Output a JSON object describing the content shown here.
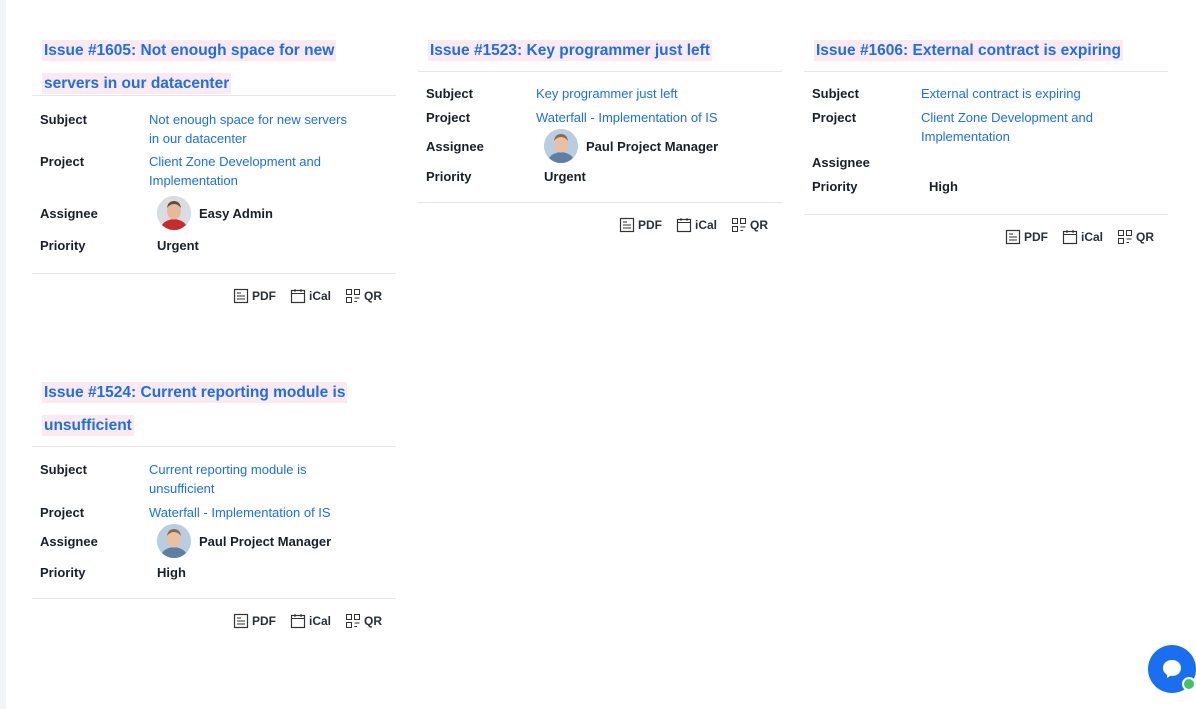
{
  "labels": {
    "subject": "Subject",
    "project": "Project",
    "assignee": "Assignee",
    "priority": "Priority",
    "pdf": "PDF",
    "ical": "iCal",
    "qr": "QR"
  },
  "cards": [
    {
      "title_line1": "Issue #1605: Not enough space for new",
      "title_line2": "servers in our datacenter",
      "subject_line1": "Not enough space for new servers",
      "subject_line2": "in our datacenter",
      "project_line1": "Client Zone Development and",
      "project_line2": "Implementation",
      "assignee": "Easy Admin",
      "priority": "Urgent"
    },
    {
      "title_line1": "Issue #1523: Key programmer just left",
      "subject_line1": "Key programmer just left",
      "project_line1": "Waterfall - Implementation of IS",
      "assignee": "Paul Project Manager",
      "priority": "Urgent"
    },
    {
      "title_line1": "Issue #1606: External contract is expiring",
      "subject_line1": "External contract is expiring",
      "project_line1": "Client Zone Development and",
      "project_line2": "Implementation",
      "assignee": "",
      "priority": "High"
    },
    {
      "title_line1": "Issue #1524: Current reporting module is",
      "title_line2": "unsufficient",
      "subject_line1": "Current reporting module is",
      "subject_line2": "unsufficient",
      "project_line1": "Waterfall - Implementation of IS",
      "assignee": "Paul Project Manager",
      "priority": "High"
    }
  ],
  "colors": {
    "accent": "#1a6ff0",
    "title_highlight": "#fdeaf0",
    "chat_online": "#3ec45c"
  },
  "icons": [
    "pdf-icon",
    "calendar-icon",
    "qr-icon",
    "chat-icon",
    "avatar"
  ]
}
